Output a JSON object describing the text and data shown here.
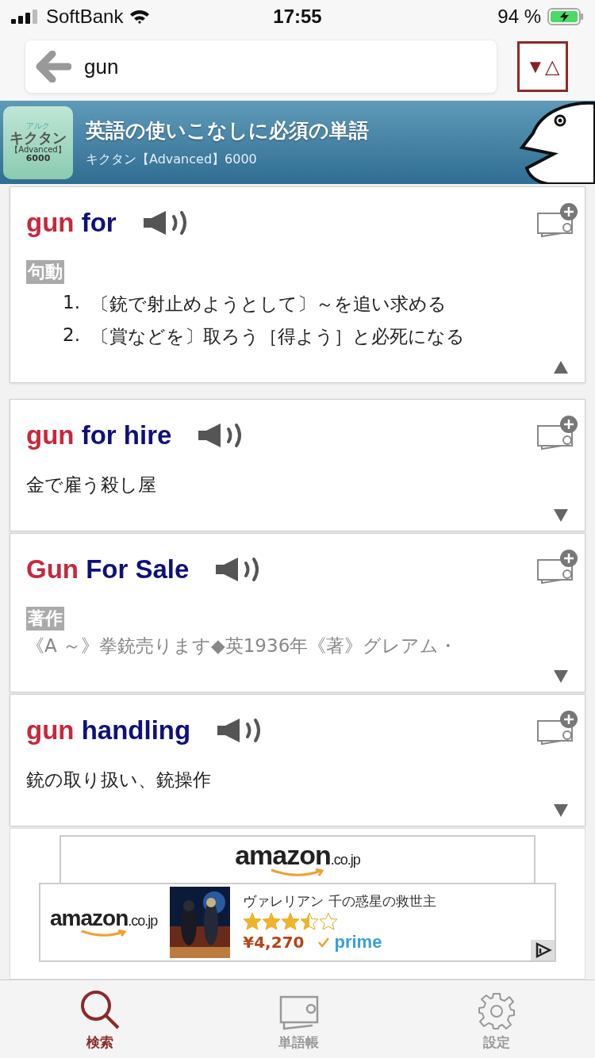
{
  "status_bar": {
    "carrier": "SoftBank",
    "time": "17:55",
    "battery": "94 %"
  },
  "search": {
    "value": "gun",
    "sort_button": {
      "down": "▼",
      "up": "△"
    }
  },
  "banner": {
    "logo": {
      "brand": "アルク",
      "name": "キクタン",
      "edition": "【Advanced】",
      "count": "6000"
    },
    "title": "英語の使いこなしに必須の単語",
    "subtitle": "キクタン【Advanced】6000"
  },
  "entries": [
    {
      "head": "gun",
      "rest": "for",
      "expanded": true,
      "pos": "句動",
      "senses": [
        {
          "num": "1.",
          "text": "〔銃で射止めようとして〕～を追い求める"
        },
        {
          "num": "2.",
          "text": "〔賞などを〕取ろう［得よう］と必死になる"
        }
      ]
    },
    {
      "head": "gun",
      "rest": "for hire",
      "expanded": false,
      "definition": "金で雇う殺し屋"
    },
    {
      "head": "Gun",
      "rest": "For Sale",
      "expanded": false,
      "pos": "著作",
      "definition": "《A ～》拳銃売ります◆英1936年《著》グレアム・"
    },
    {
      "head": "gun",
      "rest": "handling",
      "expanded": false,
      "definition": "銃の取り扱い、銃操作"
    }
  ],
  "ad": {
    "top_logo": {
      "word": "amazon",
      "domain": ".co.jp"
    },
    "logo": {
      "word": "amazon",
      "domain": ".co.jp"
    },
    "title": "ヴァレリアン 千の惑星の救世主",
    "stars": 3.5,
    "price": "¥4,270",
    "prime": "prime"
  },
  "tabs": [
    {
      "label": "検索",
      "selected": true,
      "kind": "search"
    },
    {
      "label": "単語帳",
      "selected": false,
      "kind": "wordbook"
    },
    {
      "label": "設定",
      "selected": false,
      "kind": "settings"
    }
  ]
}
